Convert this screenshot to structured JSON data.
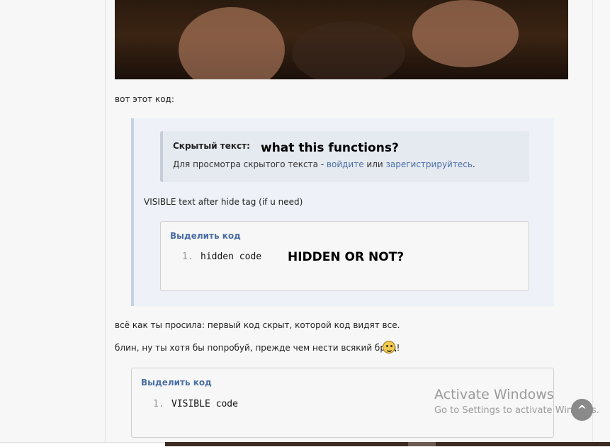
{
  "post": {
    "intro_text": "вот этот код:",
    "hidden": {
      "title": "Скрытый текст:",
      "overlay_caption": "what this functions?",
      "note_prefix": "Для просмотра скрытого текста - ",
      "login_link": "войдите",
      "or_word": " или ",
      "register_link": "зарегистрируйтесь",
      "note_suffix": "."
    },
    "visible_after_text": "VISIBLE text after hide tag (if u need)",
    "inner_code": {
      "select_label": "Выделить код",
      "line_number": "1.",
      "code": "hidden code",
      "overlay_caption": "HIDDEN OR NOT?"
    },
    "reply_line_1": "всё как ты просила: первый код скрыт, которой код видят все.",
    "reply_line_2": "блин, ну ты хотя бы попробуй, прежде чем нести всякий бред!",
    "outer_code": {
      "select_label": "Выделить код",
      "line_number": "1.",
      "code": "VISIBLE code"
    }
  },
  "watermark": {
    "title": "Activate Windows",
    "subtitle": "Go to Settings to activate Windows."
  },
  "scroll_top_glyph": "^",
  "icons": {
    "emoji": "smiley-emoji-icon",
    "scroll": "chevron-up-icon"
  },
  "colors": {
    "link": "#4a6fa5",
    "quote_bg": "#eef2f8",
    "hidden_bg": "#e5e9f0"
  }
}
